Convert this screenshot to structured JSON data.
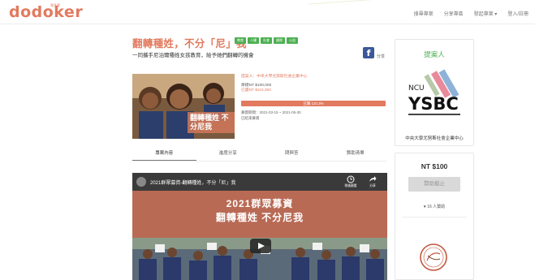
{
  "brand": {
    "logo": "dodoker",
    "logo_sup": "眾多客",
    "color": "#e27a5f"
  },
  "nav": [
    "搜尋專案",
    "分享專區",
    "發起專案 ▾",
    "登入/註冊"
  ],
  "project": {
    "title": "翻轉種姓，不分「尼」我",
    "tags": [
      "教育",
      "人權",
      "社會",
      "國際",
      "公益"
    ],
    "subtitle": "一同攜手尼泊爾種姓女孩教育，給予她們翻轉的機會",
    "share": "分享",
    "cover_text": "翻轉種姓 不分尼我",
    "proposer_line": "提案人：中央大學尤努斯社會企業中心",
    "goal": "目標NT $100,000",
    "raised": "已籌NT $110,350",
    "progress_label": "已籌 110.3%",
    "progress_fraction": 1.0,
    "period": "募資期間：2021-03-15 ~ 2021-05-30",
    "status": "已結束募資"
  },
  "tabs": [
    "專案內容",
    "進度分享",
    "問與答",
    "贊助清單"
  ],
  "video": {
    "title": "2021群眾募資-翻轉種姓，不分「尼」我",
    "watch_later": "稍後觀看",
    "share": "分享",
    "banner_line1": "2021群眾募資",
    "banner_line2": "翻轉種姓 不分尼我"
  },
  "sidebar": {
    "proposer_title": "提案人",
    "org_logo_text": "YSBC",
    "org_logo_small": "NCU",
    "org_name": "中央大學尤努斯社會企業中心",
    "reward_price": "NT $100",
    "sponsor_button": "贊助截止",
    "supporters": "♥ 16 人贊助",
    "accent_green": "#4caf50"
  }
}
